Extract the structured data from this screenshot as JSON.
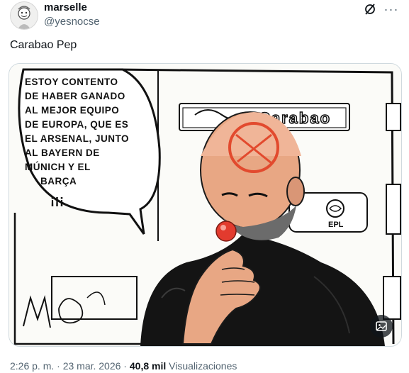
{
  "author": {
    "name": "marselle",
    "handle": "@yesnocse"
  },
  "post": {
    "text": "Carabao Pep"
  },
  "cartoon": {
    "speech_lines": [
      "ESTOY CONTENTO",
      "DE HABER GANADO",
      "AL MEJOR EQUIPO",
      "DE EUROPA, QUE ES",
      "EL ARSENAL, JUNTO",
      "AL BAYERN DE",
      "MÚNICH Y EL",
      "BARÇA",
      "¡¡¡"
    ],
    "board_text": "Carabao",
    "board_badge": "EPL"
  },
  "meta": {
    "timestamp": "2:26 p. m. · 23 mar. 2026",
    "separator": " · ",
    "views_count": "40,8 mil",
    "views_label": "Visualizaciones"
  },
  "colors": {
    "text_primary": "#0f1419",
    "text_secondary": "#536471",
    "border": "#cfd9de",
    "nose": "#e23b2e"
  },
  "icons": [
    "avatar",
    "grok-icon",
    "more-icon",
    "alt-text-icon"
  ]
}
